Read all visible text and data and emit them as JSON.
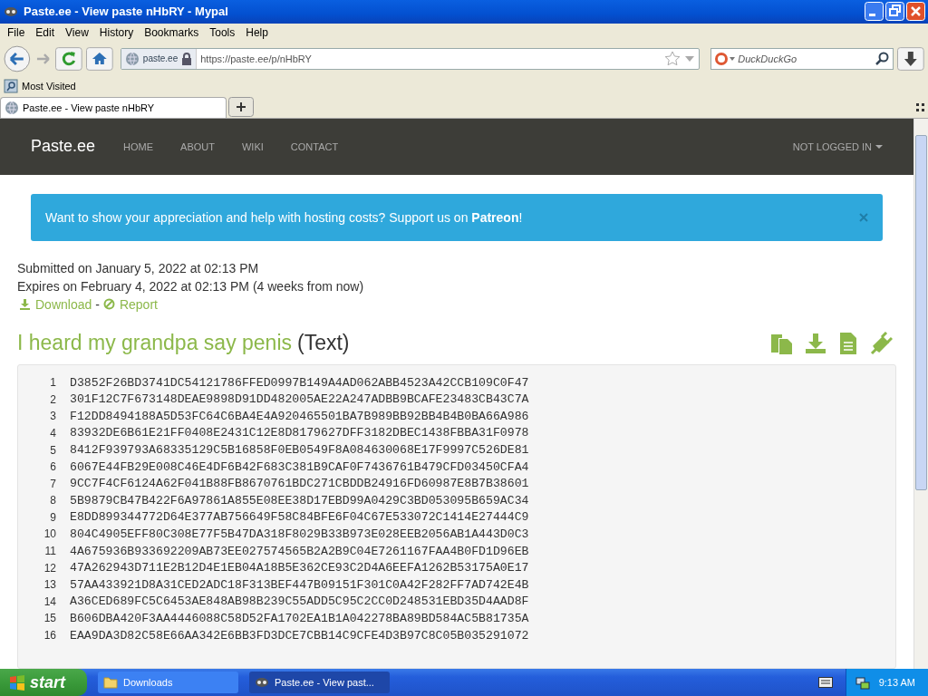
{
  "window": {
    "title": "Paste.ee - View paste nHbRY - Mypal"
  },
  "menu": [
    "File",
    "Edit",
    "View",
    "History",
    "Bookmarks",
    "Tools",
    "Help"
  ],
  "toolbar": {
    "site": "paste.ee",
    "url": "https://paste.ee/p/nHbRY",
    "search_placeholder": "DuckDuckGo"
  },
  "bookmarks": [
    "Most Visited"
  ],
  "tabs": [
    {
      "label": "Paste.ee - View paste nHbRY",
      "selected": true
    }
  ],
  "page": {
    "brand": "Paste.ee",
    "nav": [
      "HOME",
      "ABOUT",
      "WIKI",
      "CONTACT"
    ],
    "account": "NOT LOGGED IN",
    "alert": "Want to show your appreciation and help with hosting costs? Support us on **Patreon**!",
    "submitted": "Submitted on January 5, 2022 at 02:13 PM",
    "expires": "Expires on February 4, 2022 at 02:13 PM (4 weeks from now)",
    "links": [
      {
        "kind": "download",
        "label": "Download"
      },
      {
        "kind": "report",
        "label": "Report"
      }
    ],
    "separator": "-",
    "title": "I heard my grandpa say penis",
    "type": "(Text)",
    "lines": [
      {
        "number": "1",
        "text": "D3852F26BD3741DC54121786FFED0997B149A4AD062ABB4523A42CCB109C0F47"
      },
      {
        "number": "2",
        "text": "301F12C7F673148DEAE9898D91DD482005AE22A247ADBB9BCAFE23483CB43C7A"
      },
      {
        "number": "3",
        "text": "F12DD8494188A5D53FC64C6BA4E4A920465501BA7B989BB92BB4B4B0BA66A986"
      },
      {
        "number": "4",
        "text": "83932DE6B61E21FF0408E2431C12E8D8179627DFF3182DBEC1438FBBA31F0978"
      },
      {
        "number": "5",
        "text": "8412F939793A68335129C5B16858F0EB0549F8A084630068E17F9997C526DE81"
      },
      {
        "number": "6",
        "text": "6067E44FB29E008C46E4DF6B42F683C381B9CAF0F7436761B479CFD03450CFA4"
      },
      {
        "number": "7",
        "text": "9CC7F4CF6124A62F041B88FB8670761BDC271CBDDB24916FD60987E8B7B38601"
      },
      {
        "number": "8",
        "text": "5B9879CB47B422F6A97861A855E08EE38D17EBD99A0429C3BD053095B659AC34"
      },
      {
        "number": "9",
        "text": "E8DD899344772D64E377AB756649F58C84BFE6F04C67E533072C1414E27444C9"
      },
      {
        "number": "10",
        "text": "804C4905EFF80C308E77F5B47DA318F8029B33B973E028EEB2056AB1A443D0C3"
      },
      {
        "number": "11",
        "text": "4A675936B933692209AB73EE027574565B2A2B9C04E7261167FAA4B0FD1D96EB"
      },
      {
        "number": "12",
        "text": "47A262943D711E2B12D4E1EB04A18B5E362CE93C2D4A6EEFA1262B53175A0E17"
      },
      {
        "number": "13",
        "text": "57AA433921D8A31CED2ADC18F313BEF447B09151F301C0A42F282FF7AD742E4B"
      },
      {
        "number": "14",
        "text": "A36CED689FC5C6453AE848AB98B239C55ADD5C95C2CC0D248531EBD35D4AAD8F"
      },
      {
        "number": "15",
        "text": "B606DBA420F3AA4446088C58D52FA1702EA1B1A042278BA89BD584AC5B81735A"
      },
      {
        "number": "16",
        "text": "EAA9DA3D82C58E66AA342E6BB3FD3DCE7CBB14C9CFE4D3B97C8C05B035291072"
      }
    ]
  },
  "taskbar": {
    "start": "start",
    "tasks": [
      {
        "label": "Downloads",
        "kind": "folder",
        "selected": false
      },
      {
        "label": "Paste.ee - View past...",
        "kind": "browser",
        "selected": true
      }
    ],
    "clock": "9:13 AM"
  }
}
